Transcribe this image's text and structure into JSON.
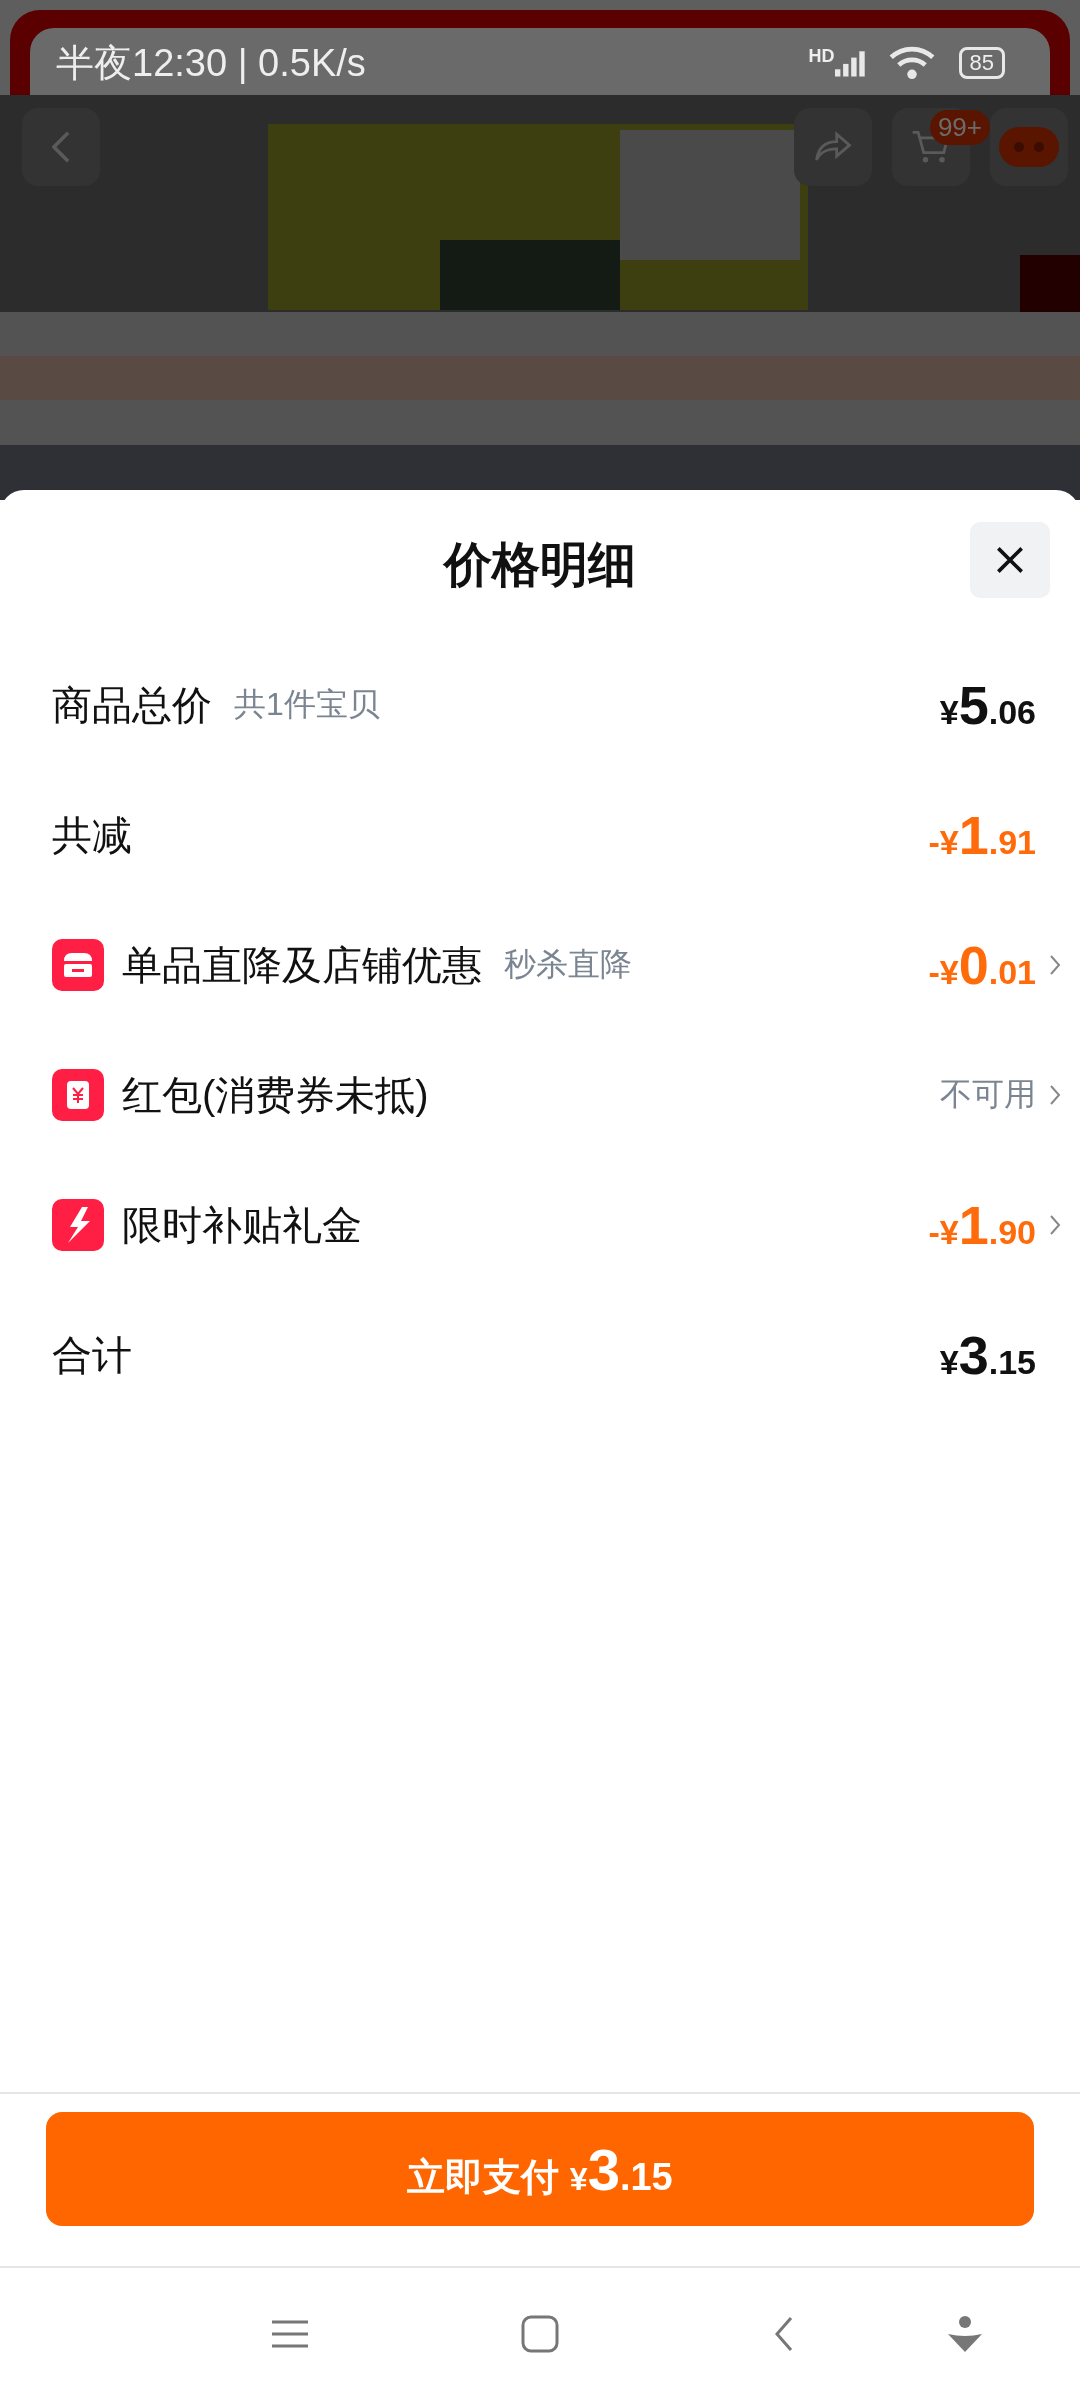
{
  "status_bar": {
    "time": "半夜12:30 | 0.5K/s",
    "network": "HD",
    "battery": "85"
  },
  "background_page": {
    "kind": "picture",
    "cart_badge": "99+"
  },
  "sheet": {
    "title": "价格明细",
    "rows": [
      {
        "kind": "plain",
        "label": "商品总价",
        "note": "共1件宝贝",
        "amount": {
          "prefix": "¥",
          "int": "5",
          "dec": ".06"
        },
        "highlight": false,
        "has_details": false
      },
      {
        "kind": "plain",
        "label": "共减",
        "amount": {
          "prefix": "-¥",
          "int": "1",
          "dec": ".91"
        },
        "highlight": true,
        "has_details": false
      },
      {
        "kind": "store",
        "label": "单品直降及店铺优惠",
        "note": "秒杀直降",
        "amount": {
          "prefix": "-¥",
          "int": "0",
          "dec": ".01"
        },
        "highlight": true,
        "has_details": true
      },
      {
        "kind": "coupon",
        "label": "红包(消费券未抵)",
        "status": "不可用",
        "highlight": false,
        "has_details": true
      },
      {
        "kind": "bolt",
        "label": "限时补贴礼金",
        "amount": {
          "prefix": "-¥",
          "int": "1",
          "dec": ".90"
        },
        "highlight": true,
        "has_details": true
      },
      {
        "kind": "plain",
        "label": "合计",
        "amount": {
          "prefix": "¥",
          "int": "3",
          "dec": ".15"
        },
        "highlight": false,
        "has_details": false
      }
    ],
    "pay_button": {
      "label": "立即支付",
      "amount": {
        "prefix": "¥",
        "int": "3",
        "dec": ".15"
      }
    }
  }
}
